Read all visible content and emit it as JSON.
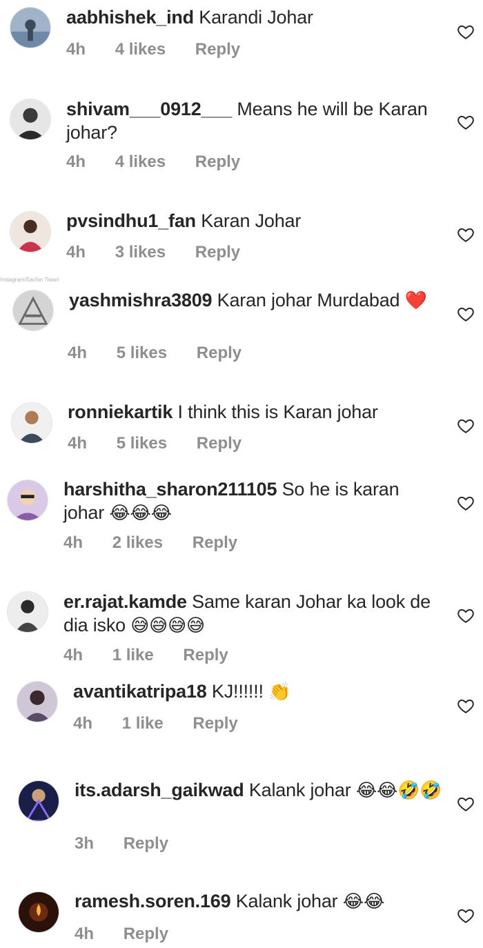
{
  "credit": "Instagram/Sachin Tiwari",
  "comments": [
    {
      "username": "aabhishek_ind",
      "text": "Karandi Johar",
      "emoji": "",
      "time": "4h",
      "likes": "4 likes",
      "reply": "Reply",
      "avatar_color": "#6f8aa8"
    },
    {
      "username": "shivam___0912___",
      "text": "Means he will be Karan johar?",
      "emoji": "",
      "time": "4h",
      "likes": "4 likes",
      "reply": "Reply",
      "avatar_color": "#7a7a7a"
    },
    {
      "username": "pvsindhu1_fan",
      "text": "Karan Johar",
      "emoji": "",
      "time": "4h",
      "likes": "3 likes",
      "reply": "Reply",
      "avatar_color": "#c9354a"
    },
    {
      "username": "yashmishra3809",
      "text": "Karan johar Murdabad",
      "emoji": "❤️",
      "time": "4h",
      "likes": "5 likes",
      "reply": "Reply",
      "avatar_color": "#9c9c9c"
    },
    {
      "username": "ronniekartik",
      "text": "I think this is Karan johar",
      "emoji": "",
      "time": "4h",
      "likes": "5 likes",
      "reply": "Reply",
      "avatar_color": "#3d4a5c"
    },
    {
      "username": "harshitha_sharon211105",
      "text": "So he is karan johar",
      "emoji": "😂😂😂",
      "time": "4h",
      "likes": "2 likes",
      "reply": "Reply",
      "avatar_color": "#8a5ca8"
    },
    {
      "username": "er.rajat.kamde",
      "text": "Same karan Johar ka look de dia isko",
      "emoji": "😅😅😅😅",
      "time": "4h",
      "likes": "1 like",
      "reply": "Reply",
      "avatar_color": "#444444"
    },
    {
      "username": "avantikatripa18",
      "text": "KJ!!!!!!",
      "emoji": "👏",
      "time": "4h",
      "likes": "1 like",
      "reply": "Reply",
      "avatar_color": "#5a4a66"
    },
    {
      "username": "its.adarsh_gaikwad",
      "text": "Kalank johar",
      "emoji": "😂😂🤣🤣",
      "time": "3h",
      "likes": "",
      "reply": "Reply",
      "avatar_color": "#2a2f6b"
    },
    {
      "username": "ramesh.soren.169",
      "text": "Kalank johar",
      "emoji": "😂😂",
      "time": "4h",
      "likes": "",
      "reply": "Reply",
      "avatar_color": "#3b1c10"
    }
  ],
  "icons": {
    "heart": "heart-outline-icon"
  }
}
